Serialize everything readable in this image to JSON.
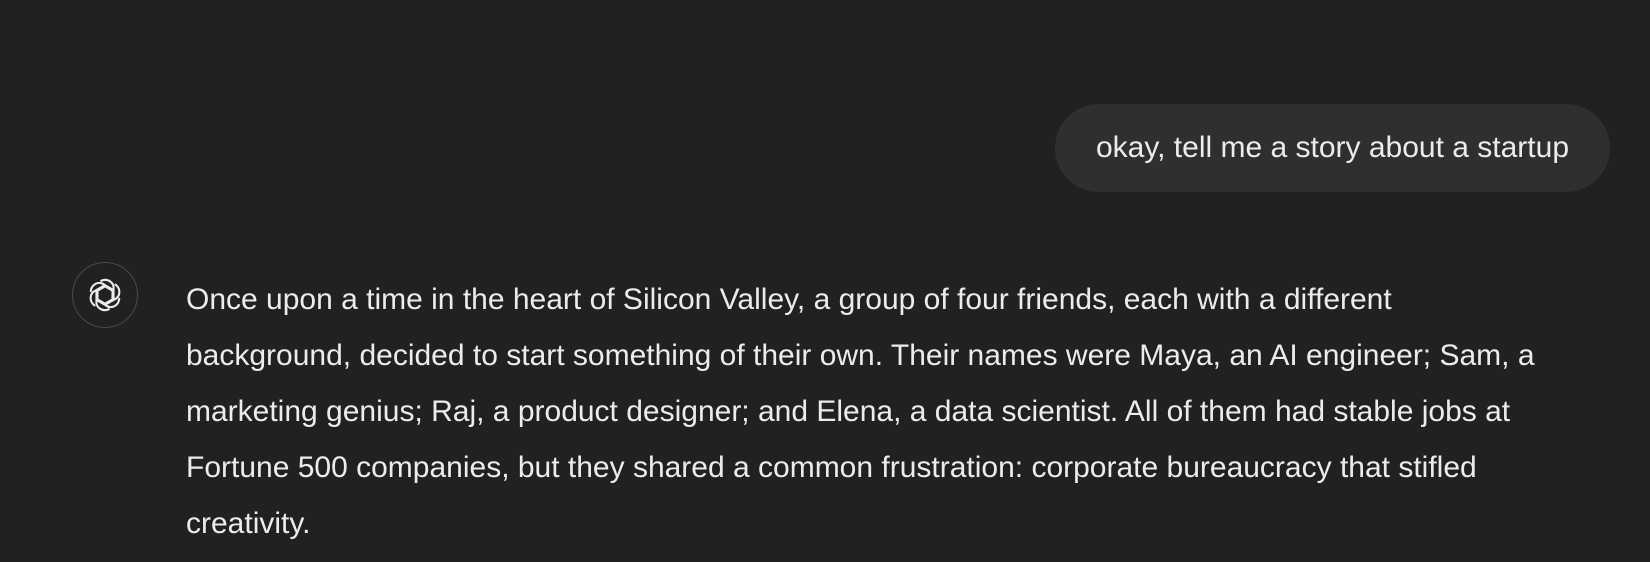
{
  "conversation": {
    "user_message": "okay, tell me a story about a startup",
    "assistant_icon": "openai-logo-icon",
    "assistant_message": "Once upon a time in the heart of Silicon Valley, a group of four friends, each with a different background, decided to start something of their own. Their names were Maya, an AI engineer; Sam, a marketing genius; Raj, a product designer; and Elena, a data scientist. All of them had stable jobs at Fortune 500 companies, but they shared a common frustration: corporate bureaucracy that stifled creativity."
  },
  "colors": {
    "background": "#212121",
    "user_bubble": "#2f2f2f",
    "text": "#ececec",
    "avatar_border": "#4a4a4a"
  }
}
